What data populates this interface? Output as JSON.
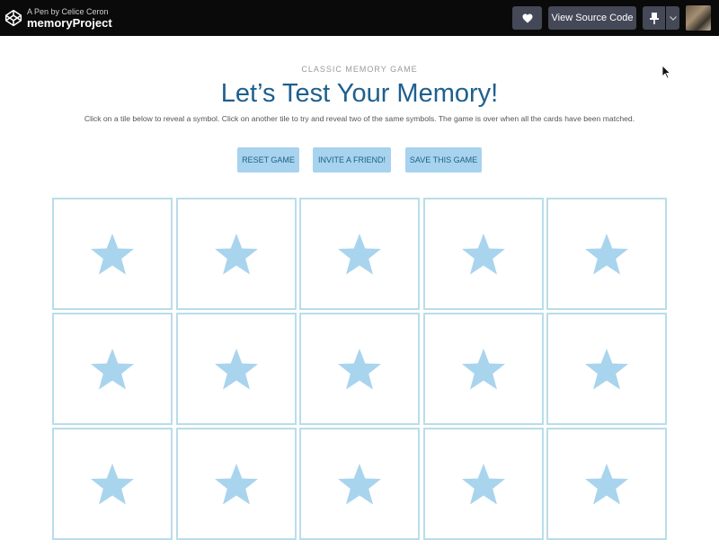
{
  "topbar": {
    "pen_by": "A Pen by Celice Ceron",
    "pen_title": "memoryProject",
    "heart_icon": "heart-icon",
    "view_source_label": "View Source Code",
    "pin_icon": "pin-icon",
    "caret_icon": "chevron-down-icon"
  },
  "page": {
    "kicker": "CLASSIC MEMORY GAME",
    "title": "Let’s Test Your Memory!",
    "description": "Click on a tile below to reveal a symbol. Click on another tile to try and reveal two of the same symbols. The game is over when all the cards have been matched."
  },
  "actions": {
    "reset": "RESET GAME",
    "invite": "INVITE A FRIEND!",
    "save": "SAVE THIS GAME"
  },
  "tiles": {
    "count": 15,
    "icon": "star-icon"
  },
  "colors": {
    "topbar_bg": "#0a0a0a",
    "button_bg": "#444857",
    "accent_title": "#1e5f8e",
    "action_bg": "#a7d3ee",
    "tile_border": "#b9dde9",
    "star": "#a9d4ee"
  }
}
